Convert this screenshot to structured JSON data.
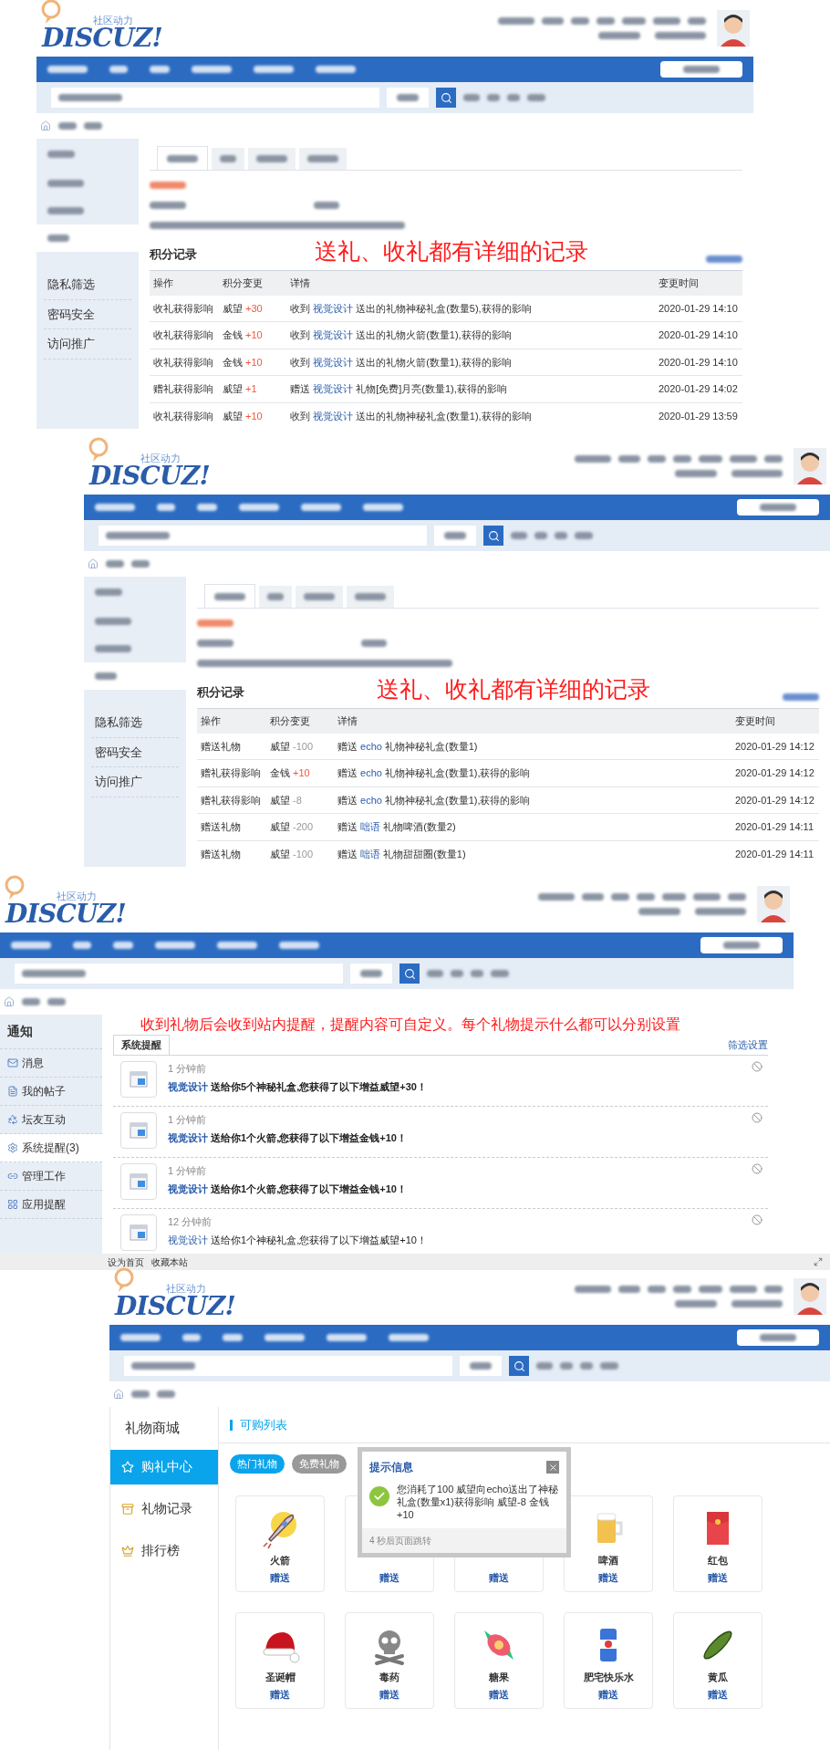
{
  "credit_panels": [
    {
      "logo": {
        "tagline": "社区动力",
        "name": "DISCUZ!"
      },
      "annotation": "送礼、收礼都有详细的记录",
      "sidebar": {
        "items": [
          {
            "label": "隐私筛选"
          },
          {
            "label": "密码安全"
          },
          {
            "label": "访问推广"
          }
        ]
      },
      "records": {
        "title": "积分记录",
        "columns": [
          "操作",
          "积分变更",
          "详情",
          "变更时间"
        ],
        "rows": [
          {
            "action": "收礼获得影响",
            "change": {
              "label": "威望",
              "amount": "+30",
              "kind": "gain"
            },
            "detail": {
              "verb": "收到",
              "user": "视觉设计",
              "text": "送出的礼物神秘礼盒(数量5),获得的影响"
            },
            "time": "2020-01-29 14:10"
          },
          {
            "action": "收礼获得影响",
            "change": {
              "label": "金钱",
              "amount": "+10",
              "kind": "gain"
            },
            "detail": {
              "verb": "收到",
              "user": "视觉设计",
              "text": "送出的礼物火箭(数量1),获得的影响"
            },
            "time": "2020-01-29 14:10"
          },
          {
            "action": "收礼获得影响",
            "change": {
              "label": "金钱",
              "amount": "+10",
              "kind": "gain"
            },
            "detail": {
              "verb": "收到",
              "user": "视觉设计",
              "text": "送出的礼物火箭(数量1),获得的影响"
            },
            "time": "2020-01-29 14:10"
          },
          {
            "action": "赠礼获得影响",
            "change": {
              "label": "威望",
              "amount": "+1",
              "kind": "gain"
            },
            "detail": {
              "verb": "赠送",
              "user": "视觉设计",
              "text": "礼物[免费]月亮(数量1),获得的影响"
            },
            "time": "2020-01-29 14:02"
          },
          {
            "action": "收礼获得影响",
            "change": {
              "label": "威望",
              "amount": "+10",
              "kind": "gain"
            },
            "detail": {
              "verb": "收到",
              "user": "视觉设计",
              "text": "送出的礼物神秘礼盒(数量1),获得的影响"
            },
            "time": "2020-01-29 13:59"
          }
        ]
      }
    },
    {
      "logo": {
        "tagline": "社区动力",
        "name": "DISCUZ!"
      },
      "annotation": "送礼、收礼都有详细的记录",
      "sidebar": {
        "items": [
          {
            "label": "隐私筛选"
          },
          {
            "label": "密码安全"
          },
          {
            "label": "访问推广"
          }
        ]
      },
      "records": {
        "title": "积分记录",
        "columns": [
          "操作",
          "积分变更",
          "详情",
          "变更时间"
        ],
        "rows": [
          {
            "action": "赠送礼物",
            "change": {
              "label": "威望",
              "amount": "-100",
              "kind": "loss"
            },
            "detail": {
              "verb": "赠送",
              "user": "echo",
              "text": "礼物神秘礼盒(数量1)"
            },
            "time": "2020-01-29 14:12"
          },
          {
            "action": "赠礼获得影响",
            "change": {
              "label": "金钱",
              "amount": "+10",
              "kind": "gain"
            },
            "detail": {
              "verb": "赠送",
              "user": "echo",
              "text": "礼物神秘礼盒(数量1),获得的影响"
            },
            "time": "2020-01-29 14:12"
          },
          {
            "action": "赠礼获得影响",
            "change": {
              "label": "威望",
              "amount": "-8",
              "kind": "loss"
            },
            "detail": {
              "verb": "赠送",
              "user": "echo",
              "text": "礼物神秘礼盒(数量1),获得的影响"
            },
            "time": "2020-01-29 14:12"
          },
          {
            "action": "赠送礼物",
            "change": {
              "label": "威望",
              "amount": "-200",
              "kind": "loss"
            },
            "detail": {
              "verb": "赠送",
              "user": "咄语",
              "text": "礼物啤酒(数量2)"
            },
            "time": "2020-01-29 14:11"
          },
          {
            "action": "赠送礼物",
            "change": {
              "label": "威望",
              "amount": "-100",
              "kind": "loss"
            },
            "detail": {
              "verb": "赠送",
              "user": "咄语",
              "text": "礼物甜甜圈(数量1)"
            },
            "time": "2020-01-29 14:11"
          }
        ]
      }
    }
  ],
  "notice_panel": {
    "logo": {
      "tagline": "社区动力",
      "name": "DISCUZ!"
    },
    "annotation": "收到礼物后会收到站内提醒，提醒内容可自定义。每个礼物提示什么都可以分别设置",
    "sidebar": {
      "title": "通知",
      "items": [
        {
          "label": "消息",
          "selected": false
        },
        {
          "label": "我的帖子",
          "selected": false
        },
        {
          "label": "坛友互动",
          "selected": false
        },
        {
          "label": "系统提醒(3)",
          "selected": true
        },
        {
          "label": "管理工作",
          "selected": false
        },
        {
          "label": "应用提醒",
          "selected": false
        }
      ]
    },
    "tab": "系统提醒",
    "filter_link": "筛选设置",
    "notices": [
      {
        "time": "1 分钟前",
        "user": "视觉设计",
        "message": "送给你5个神秘礼盒,您获得了以下增益威望+30！",
        "unread": true
      },
      {
        "time": "1 分钟前",
        "user": "视觉设计",
        "message": "送给你1个火箭,您获得了以下增益金钱+10！",
        "unread": true
      },
      {
        "time": "1 分钟前",
        "user": "视觉设计",
        "message": "送给你1个火箭,您获得了以下增益金钱+10！",
        "unread": true
      },
      {
        "time": "12 分钟前",
        "user": "视觉设计",
        "message": "送给你1个神秘礼盒,您获得了以下增益威望+10！",
        "unread": false
      }
    ],
    "footer_links": [
      "设为首页",
      "收藏本站"
    ]
  },
  "gift_panel": {
    "logo": {
      "tagline": "社区动力",
      "name": "DISCUZ!"
    },
    "sidebar": {
      "title": "礼物商城",
      "items": [
        {
          "label": "购礼中心",
          "selected": true
        },
        {
          "label": "礼物记录",
          "selected": false
        },
        {
          "label": "排行榜",
          "selected": false
        }
      ]
    },
    "section_title": "可购列表",
    "tags": [
      {
        "label": "热门礼物",
        "selected": true
      },
      {
        "label": "免费礼物",
        "selected": false
      }
    ],
    "gifts": [
      {
        "name": "火箭",
        "action": "赠送"
      },
      {
        "action": "赠送"
      },
      {
        "action": "赠送"
      },
      {
        "name": "啤酒",
        "action": "赠送"
      },
      {
        "name": "红包",
        "action": "赠送"
      },
      {
        "name": "圣诞帽",
        "action": "赠送"
      },
      {
        "name": "毒药",
        "action": "赠送"
      },
      {
        "name": "糖果",
        "action": "赠送"
      },
      {
        "name": "肥宅快乐水",
        "action": "赠送"
      },
      {
        "name": "黄瓜",
        "action": "赠送"
      }
    ],
    "dialog": {
      "title": "提示信息",
      "message": "您消耗了100 威望向echo送出了神秘礼盒(数量x1)获得影响 威望-8 金钱+10",
      "footer": "4 秒后页面跳转"
    }
  }
}
